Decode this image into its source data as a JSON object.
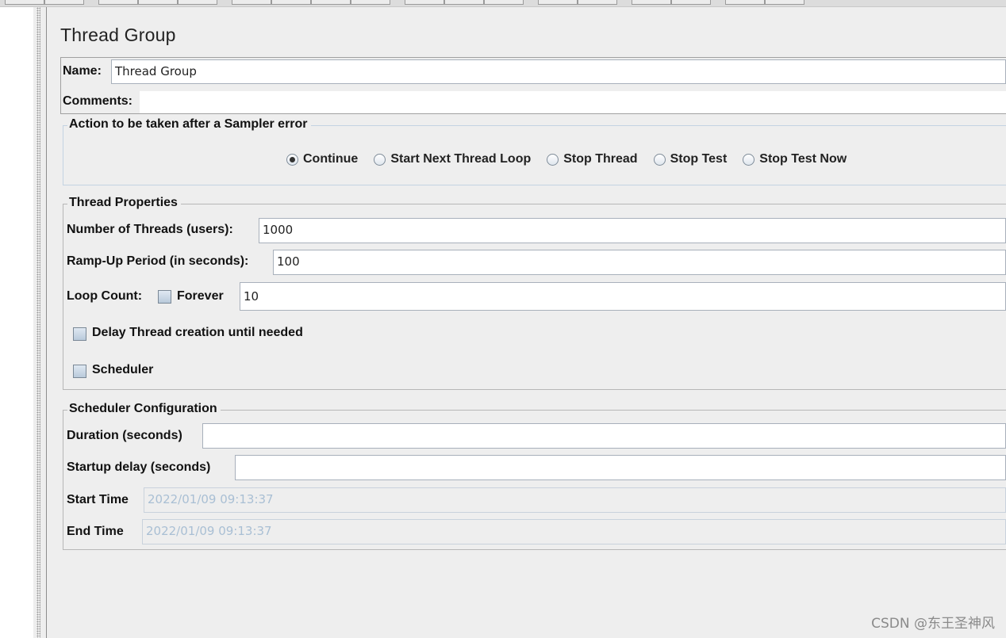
{
  "panel": {
    "title": "Thread Group",
    "name_label": "Name:",
    "name_value": "Thread Group",
    "comments_label": "Comments:",
    "comments_value": ""
  },
  "sampler_error": {
    "title": "Action to be taken after a Sampler error",
    "options": [
      {
        "label": "Continue",
        "checked": true
      },
      {
        "label": "Start Next Thread Loop",
        "checked": false
      },
      {
        "label": "Stop Thread",
        "checked": false
      },
      {
        "label": "Stop Test",
        "checked": false
      },
      {
        "label": "Stop Test Now",
        "checked": false
      }
    ]
  },
  "thread_properties": {
    "title": "Thread Properties",
    "threads_label": "Number of Threads (users):",
    "threads_value": "1000",
    "rampup_label": "Ramp-Up Period (in seconds):",
    "rampup_value": "100",
    "loop_label": "Loop Count:",
    "forever_label": "Forever",
    "forever_checked": false,
    "loop_value": "10",
    "delay_label": "Delay Thread creation until needed",
    "delay_checked": false,
    "scheduler_label": "Scheduler",
    "scheduler_checked": false
  },
  "scheduler_config": {
    "title": "Scheduler Configuration",
    "duration_label": "Duration (seconds)",
    "duration_value": "",
    "startup_label": "Startup delay (seconds)",
    "startup_value": "",
    "start_label": "Start Time",
    "start_value": "2022/01/09 09:13:37",
    "end_label": "End Time",
    "end_value": "2022/01/09 09:13:37"
  },
  "watermark": "CSDN @东王圣神风"
}
